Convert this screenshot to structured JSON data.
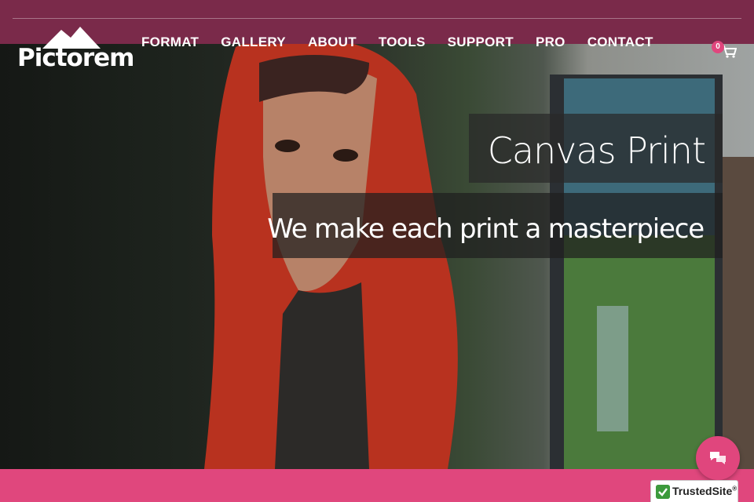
{
  "brand": {
    "name": "Pictorem"
  },
  "nav": {
    "items": [
      {
        "label": "FORMAT"
      },
      {
        "label": "GALLERY"
      },
      {
        "label": "ABOUT"
      },
      {
        "label": "TOOLS"
      },
      {
        "label": "SUPPORT"
      },
      {
        "label": "PRO"
      },
      {
        "label": "CONTACT"
      }
    ]
  },
  "cart": {
    "count": "0",
    "icon": "cart-icon"
  },
  "hero": {
    "title": "Canvas Print",
    "tagline": "We make each print a masterpiece"
  },
  "widgets": {
    "chat_icon": "chat-bubbles-icon",
    "trusted_label": "TrustedSite",
    "trusted_mark": "®"
  },
  "colors": {
    "topbar": "#7a2a4a",
    "accent": "#e0477d",
    "scarf": "#c8382a"
  }
}
